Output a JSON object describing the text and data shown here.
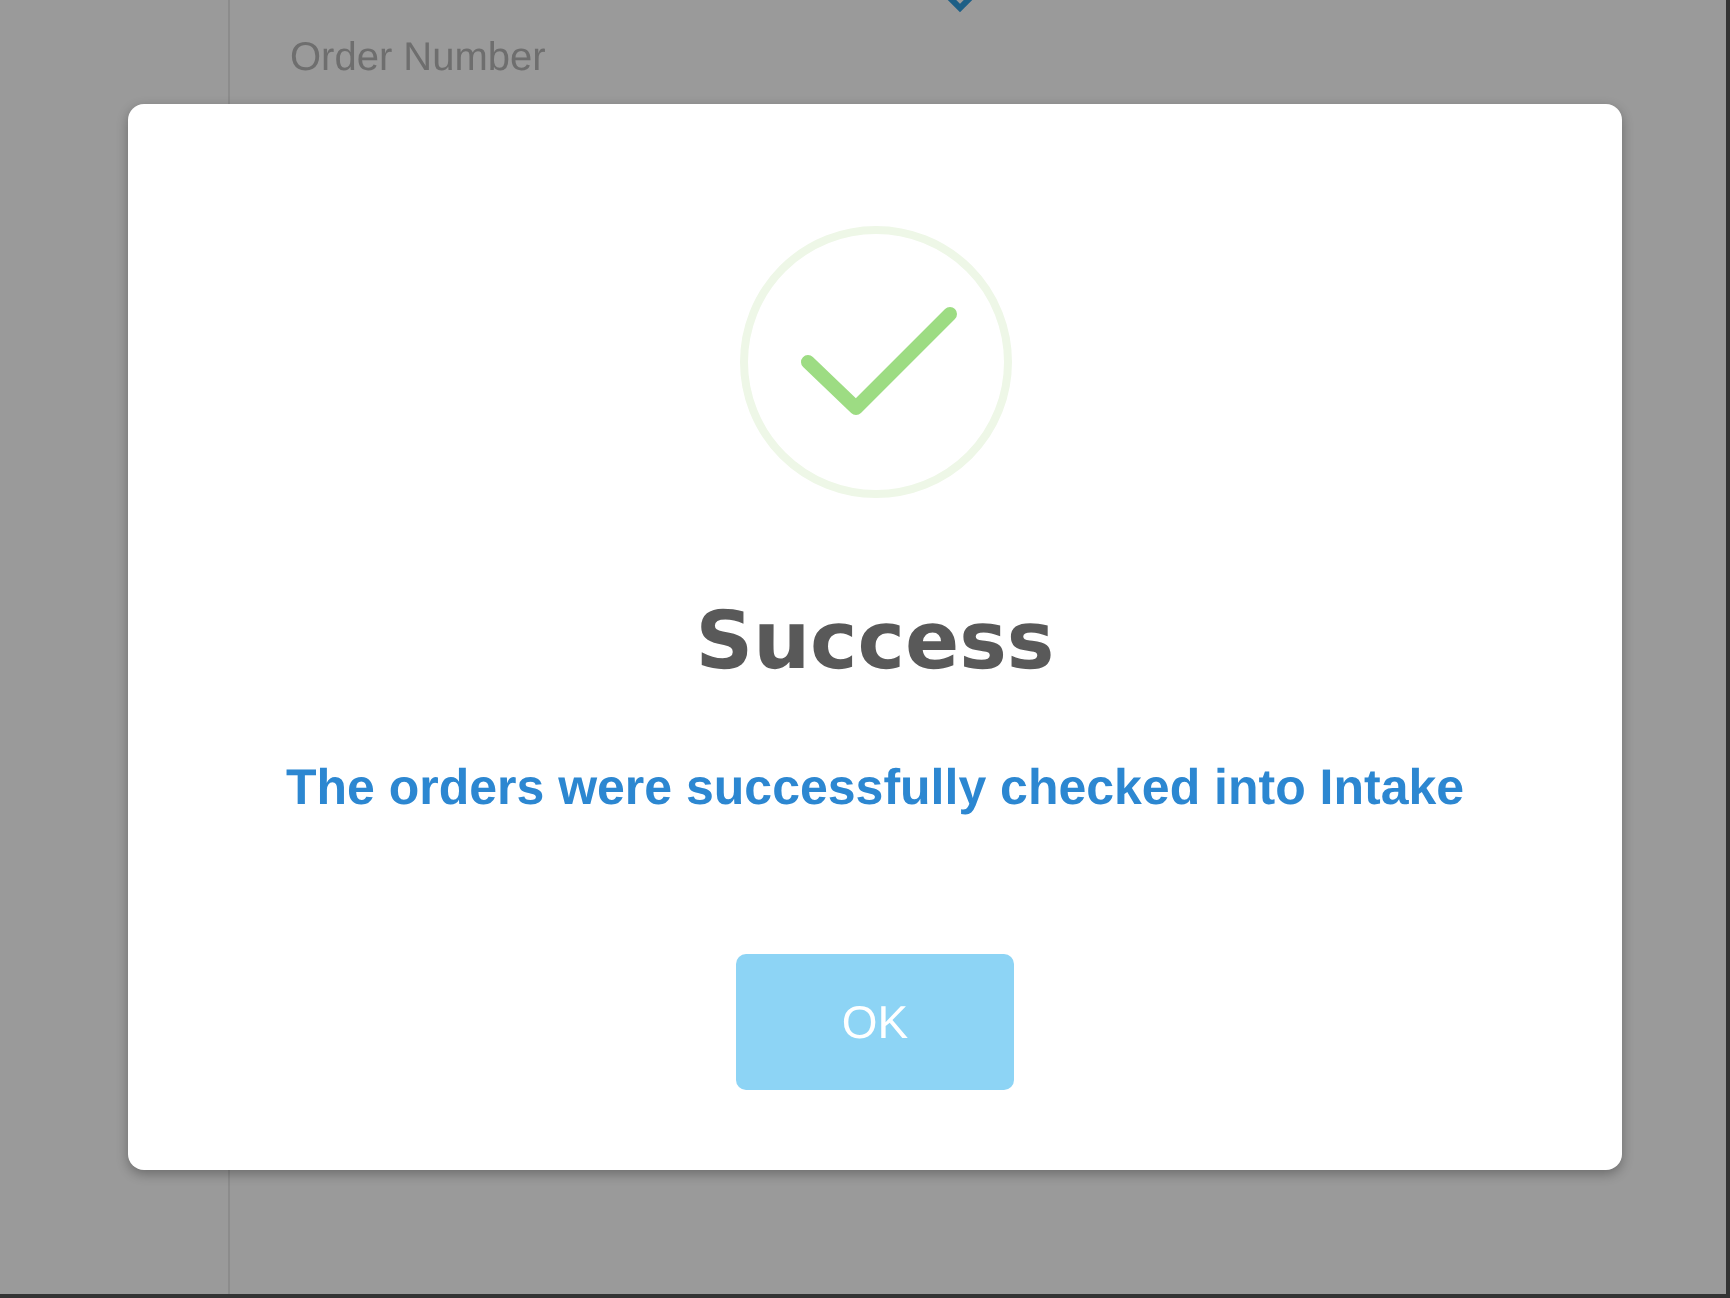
{
  "background": {
    "field_label": "Order Number"
  },
  "dialog": {
    "kind": "success",
    "title": "Success",
    "message": "The orders were successfully checked into Intake",
    "buttons": [
      {
        "label": "OK"
      }
    ]
  }
}
